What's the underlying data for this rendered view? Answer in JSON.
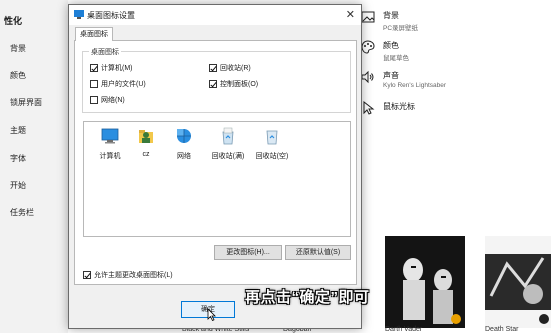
{
  "nav": {
    "header": "性化",
    "items": [
      "背景",
      "颜色",
      "锁屏界面",
      "主题",
      "字体",
      "开始",
      "任务栏"
    ]
  },
  "right_panel": {
    "rows": [
      {
        "title": "背景",
        "subtitle": "PC录屏壁纸",
        "icon": "picture-icon"
      },
      {
        "title": "颜色",
        "subtitle": "鼠尾草色",
        "icon": "palette-icon"
      },
      {
        "title": "声音",
        "subtitle": "Kylo Ren's Lightsaber",
        "icon": "speaker-icon"
      },
      {
        "title": "鼠标光标",
        "subtitle": "",
        "icon": "cursor-icon"
      }
    ],
    "themes": [
      "Black and White Stills",
      "Dagobah",
      "Darth Vader",
      "Death Star"
    ]
  },
  "dialog": {
    "title": "桌面图标设置",
    "tab": "桌面图标",
    "group_label": "桌面图标",
    "checkboxes": [
      {
        "label": "计算机(M)",
        "checked": true
      },
      {
        "label": "回收站(R)",
        "checked": true
      },
      {
        "label": "用户的文件(U)",
        "checked": false
      },
      {
        "label": "控制面板(O)",
        "checked": true
      },
      {
        "label": "网络(N)",
        "checked": false
      }
    ],
    "icons": [
      {
        "label": "计算机",
        "icon": "computer-icon"
      },
      {
        "label": "cz",
        "icon": "user-folder-icon"
      },
      {
        "label": "网络",
        "icon": "network-icon"
      },
      {
        "label": "回收站(满)",
        "icon": "recycle-bin-full-icon"
      },
      {
        "label": "回收站(空)",
        "icon": "recycle-bin-empty-icon"
      }
    ],
    "change_icon_button": "更改图标(H)...",
    "restore_default_button": "还原默认值(S)",
    "allow_theme_label": "允许主题更改桌面图标(L)",
    "allow_theme_checked": true,
    "ok_button": "确定"
  },
  "overlay_caption": "再点击“确定”即可",
  "colors": {
    "dialog_bg": "#f0f0f0",
    "accent_yellow": "#e8a000"
  }
}
